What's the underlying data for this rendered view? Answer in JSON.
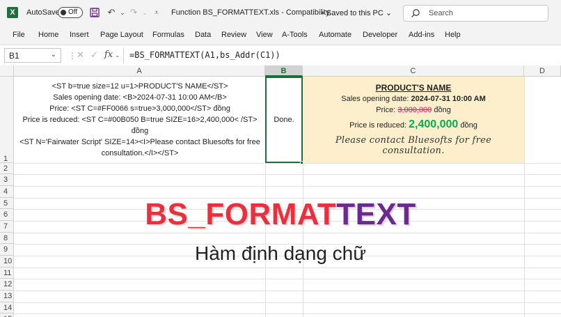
{
  "titlebar": {
    "app_icon": "excel-logo-icon",
    "app_letter": "X",
    "autosave_label": "AutoSave",
    "toggle_state": "Off",
    "save_icon": "save-icon",
    "undo_icon": "undo-icon",
    "redo_icon": "redo-icon",
    "customize_icon": "customize-qat-icon",
    "doc_title": "Function BS_FORMATTEXT.xls  -  Compatibility...",
    "saved_status": "•  Saved to this PC  ⌄",
    "search_placeholder": "Search"
  },
  "menu": {
    "items": [
      "File",
      "Home",
      "Insert",
      "Page Layout",
      "Formulas",
      "Data",
      "Review",
      "View",
      "A-Tools",
      "Automate",
      "Developer",
      "Add-ins",
      "Help"
    ]
  },
  "formula_bar": {
    "name_box": "B1",
    "fx_label": "fx",
    "formula": "=BS_FORMATTEXT(A1,bs_Addr(C1))"
  },
  "grid": {
    "columns": [
      "A",
      "B",
      "C",
      "D"
    ],
    "selected_column": "B",
    "rows": [
      "1",
      "2",
      "3",
      "4",
      "5",
      "6",
      "7",
      "8",
      "9",
      "10",
      "11",
      "12",
      "13",
      "14",
      "15"
    ],
    "cells": {
      "A1": [
        "<ST b=true size=12 u=1>PRODUCT'S NAME</ST>",
        "Sales opening date: <B>2024-07-31 10:00 AM</B>",
        "Price: <ST C=#FF0066 s=true>3,000,000</ST> đồng",
        "Price is reduced: <ST C=#00B050 B=true SIZE=16>2,400,000< /ST> đồng",
        "<ST N='Fairwater Script' SIZE=14><I>Please contact Bluesofts for free",
        "consultation.</I></ST>"
      ],
      "B1": "Done.",
      "C1": {
        "title": "PRODUCT'S NAME",
        "date_label": "Sales opening date: ",
        "date_value": "2024-07-31 10:00 AM",
        "price_label": "Price: ",
        "price_old": "3,000,000",
        "currency": " đồng",
        "reduced_label": "Price is reduced: ",
        "price_new": "2,400,000",
        "currency2": " đồng",
        "note": "Please contact Bluesofts for free consultation."
      }
    },
    "colors": {
      "c1_background": "#fdefcc",
      "strike_color": "#ff0066",
      "green": "#00b050",
      "selection": "#1e6b3c"
    }
  },
  "overlay": {
    "title_part1": "BS_FORMAT",
    "title_part2": "TEXT",
    "subtitle": "Hàm định dạng chữ",
    "colors": {
      "part1": "#e8303f",
      "part2": "#6b2b8e"
    }
  }
}
